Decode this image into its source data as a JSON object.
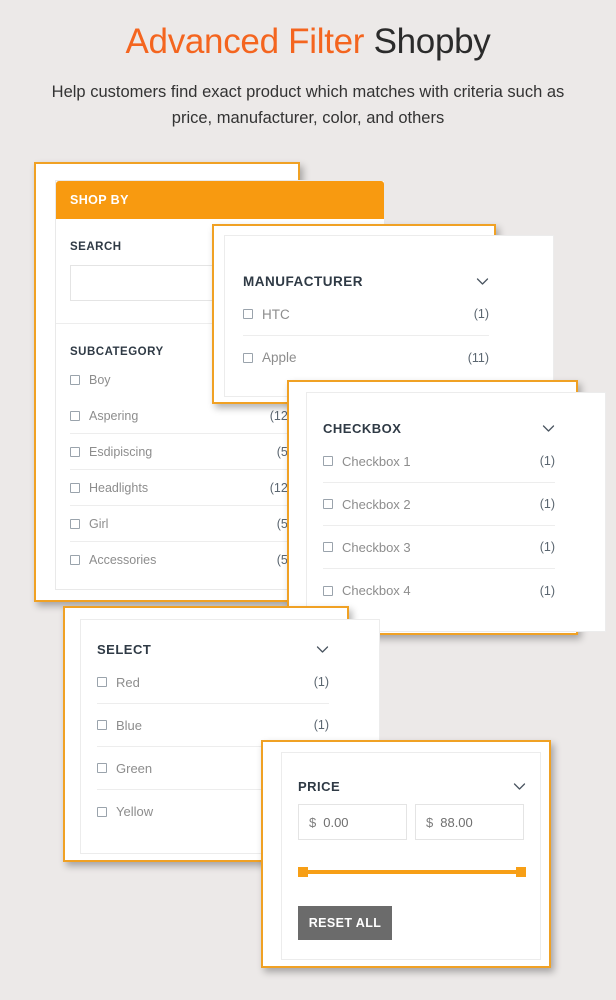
{
  "header": {
    "title_accent": "Advanced Filter",
    "title_rest": "Shopby",
    "subtitle": "Help customers find exact product which matches with criteria such as price, manufacturer, color, and others"
  },
  "colors": {
    "background": "#ece9e8",
    "accent_orange": "#f4651f",
    "panel_border": "#f0a124",
    "header_orange": "#f89a10",
    "slider_orange": "#f79f16",
    "reset_button": "#6b6b6b"
  },
  "shopby_panel": {
    "header_label": "SHOP BY",
    "search_label": "SEARCH",
    "search_value": "",
    "search_placeholder": "",
    "subcategory_label": "SUBCATEGORY",
    "items": [
      {
        "label": "Boy",
        "count": ""
      },
      {
        "label": "Aspering",
        "count": "(12)"
      },
      {
        "label": "Esdipiscing",
        "count": "(5)"
      },
      {
        "label": "Headlights",
        "count": "(12)"
      },
      {
        "label": "Girl",
        "count": "(5)"
      },
      {
        "label": "Accessories",
        "count": "(5)"
      }
    ]
  },
  "manufacturer_panel": {
    "title": "MANUFACTURER",
    "toggle_icon": "chevron-down-icon",
    "items": [
      {
        "label": "HTC",
        "count": "(1)"
      },
      {
        "label": "Apple",
        "count": "(11)"
      }
    ]
  },
  "checkbox_panel": {
    "title": "CHECKBOX",
    "toggle_icon": "chevron-down-icon",
    "items": [
      {
        "label": "Checkbox 1",
        "count": "(1)"
      },
      {
        "label": "Checkbox 2",
        "count": "(1)"
      },
      {
        "label": "Checkbox 3",
        "count": "(1)"
      },
      {
        "label": "Checkbox 4",
        "count": "(1)"
      }
    ]
  },
  "select_panel": {
    "title": "SELECT",
    "toggle_icon": "chevron-down-icon",
    "items": [
      {
        "label": "Red",
        "count": "(1)"
      },
      {
        "label": "Blue",
        "count": "(1)"
      },
      {
        "label": "Green",
        "count": ""
      },
      {
        "label": "Yellow",
        "count": ""
      }
    ]
  },
  "price_panel": {
    "title": "PRICE",
    "toggle_icon": "chevron-down-icon",
    "currency_symbol": "$",
    "min_value": "0.00",
    "max_value": "88.00",
    "reset_label": "RESET ALL"
  }
}
